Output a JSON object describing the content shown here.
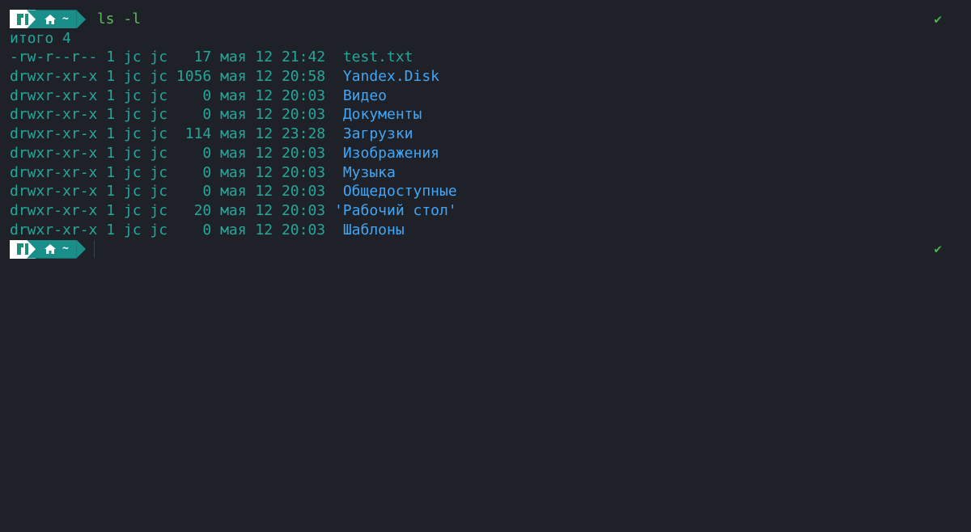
{
  "prompt": {
    "logo_icon": "manjaro-logo-icon",
    "home_icon": "home-icon",
    "path": "~",
    "status_icon": "✔",
    "colors": {
      "logo_bg": "#ffffff",
      "path_bg": "#1a8f8a",
      "status": "#4caf50"
    }
  },
  "command": "ls -l",
  "total": "итого 4",
  "entries": [
    {
      "meta": "-rw-r--r-- 1 jc jc   17 мая 12 21:42  ",
      "name": "test.txt",
      "type": "file"
    },
    {
      "meta": "drwxr-xr-x 1 jc jc 1056 мая 12 20:58  ",
      "name": "Yandex.Disk",
      "type": "dir"
    },
    {
      "meta": "drwxr-xr-x 1 jc jc    0 мая 12 20:03  ",
      "name": "Видео",
      "type": "dir"
    },
    {
      "meta": "drwxr-xr-x 1 jc jc    0 мая 12 20:03  ",
      "name": "Документы",
      "type": "dir"
    },
    {
      "meta": "drwxr-xr-x 1 jc jc  114 мая 12 23:28  ",
      "name": "Загрузки",
      "type": "dir"
    },
    {
      "meta": "drwxr-xr-x 1 jc jc    0 мая 12 20:03  ",
      "name": "Изображения",
      "type": "dir"
    },
    {
      "meta": "drwxr-xr-x 1 jc jc    0 мая 12 20:03  ",
      "name": "Музыка",
      "type": "dir"
    },
    {
      "meta": "drwxr-xr-x 1 jc jc    0 мая 12 20:03  ",
      "name": "Общедоступные",
      "type": "dir"
    },
    {
      "meta": "drwxr-xr-x 1 jc jc   20 мая 12 20:03 ",
      "name": "'Рабочий стол'",
      "type": "dir"
    },
    {
      "meta": "drwxr-xr-x 1 jc jc    0 мая 12 20:03  ",
      "name": "Шаблоны",
      "type": "dir"
    }
  ],
  "colors": {
    "background": "#1e2228",
    "text": "#26a69a",
    "directory": "#42a5f5",
    "command": "#5fb85f"
  }
}
